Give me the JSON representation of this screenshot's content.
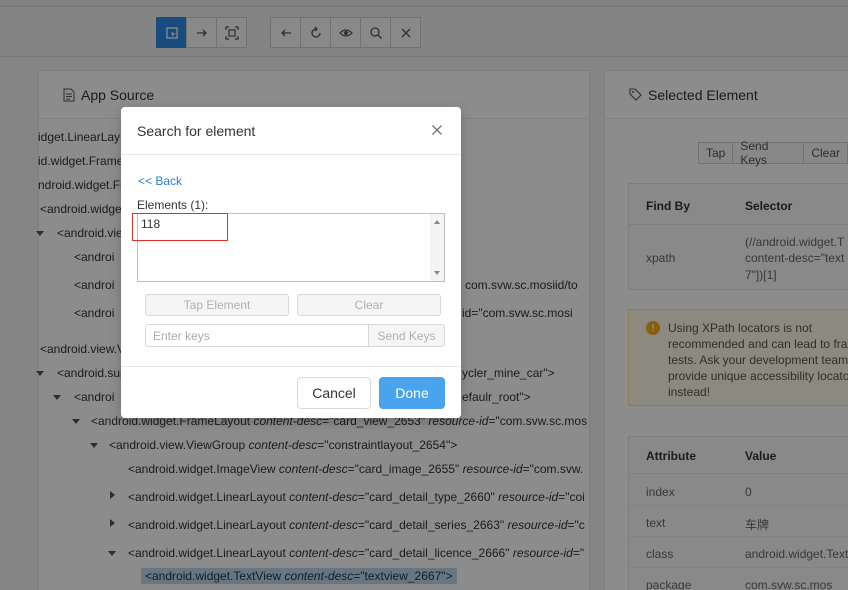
{
  "toolbar": {
    "mode_buttons": [
      "select-icon",
      "arrow-right-icon",
      "screenshot-icon"
    ],
    "action_buttons": [
      "back-icon",
      "refresh-icon",
      "eye-icon",
      "search-icon",
      "close-icon"
    ]
  },
  "app_source": {
    "title": "App Source",
    "tree": [
      {
        "text": "idget.LinearLay"
      },
      {
        "text": "id.widget.Frame"
      },
      {
        "text": "ndroid.widget.Fr"
      },
      {
        "text": "<android.widge"
      },
      {
        "text": "<android.vie"
      },
      {
        "text": "<androi"
      },
      {
        "text": "<androi",
        "suffix": "com.svw.sc.mosiid/to"
      },
      {
        "text": "<androi",
        "suffix": "id=\"com.svw.sc.mosi"
      },
      {
        "text": "<android.view.V"
      },
      {
        "text": "<android.sup",
        "suffix": "ycler_mine_car\">"
      },
      {
        "text": "<androi",
        "suffix": "efaulr_root\">"
      },
      {
        "tag": "<android.widget.FrameLayout",
        "a1": "content-desc",
        "v1": "=\"card_view_2653\"",
        "a2": "resource-id",
        "v2": "=\"com.svw.sc.mos"
      },
      {
        "tag": "<android.view.ViewGroup",
        "a1": "content-desc",
        "v1": "=\"constraintlayout_2654\">"
      },
      {
        "tag": "<android.widget.ImageView",
        "a1": "content-desc",
        "v1": "=\"card_image_2655\"",
        "a2": "resource-id",
        "v2": "=\"com.svw."
      },
      {
        "tag": "<android.widget.LinearLayout",
        "a1": "content-desc",
        "v1": "=\"card_detail_type_2660\"",
        "a2": "resource-id",
        "v2": "=\"coi"
      },
      {
        "tag": "<android.widget.LinearLayout",
        "a1": "content-desc",
        "v1": "=\"card_detail_series_2663\"",
        "a2": "resource-id",
        "v2": "=\"c"
      },
      {
        "tag": "<android.widget.LinearLayout",
        "a1": "content-desc",
        "v1": "=\"card_detail_licence_2666\"",
        "a2": "resource-id",
        "v2": "=\""
      },
      {
        "tag": "<android.widget.TextView",
        "a1": "content-desc",
        "v1": "=\"textview_2667\">"
      }
    ]
  },
  "selected_element": {
    "title": "Selected Element",
    "actions": [
      "Tap",
      "Send Keys",
      "Clear"
    ],
    "find_by": {
      "headers": [
        "Find By",
        "Selector"
      ],
      "strategy": "xpath",
      "selector": [
        "(//android.widget.T",
        "content-desc=\"text",
        "7\"])[1]"
      ]
    },
    "warning": "Using XPath locators is not\nrecommended and can lead to fra\ntests. Ask your development team\nprovide unique accessibility locato\ninstead!",
    "attributes": {
      "headers": [
        "Attribute",
        "Value"
      ],
      "rows": [
        {
          "name": "index",
          "value": "0"
        },
        {
          "name": "text",
          "value": "车牌"
        },
        {
          "name": "class",
          "value": "android.widget.Text"
        },
        {
          "name": "package",
          "value": "com.svw.sc.mos"
        }
      ]
    }
  },
  "modal": {
    "title": "Search for element",
    "back": "<< Back",
    "elements_label": "Elements (1):",
    "elements": [
      "118"
    ],
    "tap_element": "Tap Element",
    "clear": "Clear",
    "keys_placeholder": "Enter keys",
    "send_keys": "Send Keys",
    "cancel": "Cancel",
    "done": "Done"
  },
  "colors": {
    "accent": "#2f8ae5",
    "done_button": "#4aa4ed",
    "link": "#2a7fd4",
    "highlight_box": "#d9342b",
    "warning_bg": "#fffbe6"
  }
}
